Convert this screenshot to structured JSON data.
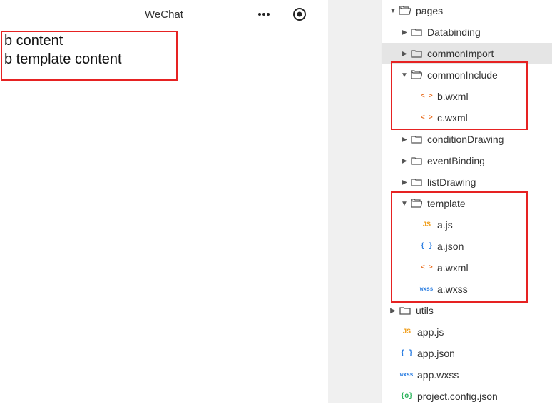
{
  "sim": {
    "title": "WeChat",
    "lines": [
      "b content",
      "b template content"
    ]
  },
  "tree": {
    "pages_label": "pages",
    "children": {
      "databinding": "Databinding",
      "commonImport": "commonImport",
      "commonInclude": "commonInclude",
      "conditionDrawing": "conditionDrawing",
      "eventBinding": "eventBinding",
      "listDrawing": "listDrawing",
      "template": "template",
      "utils": "utils"
    },
    "commonInclude_files": {
      "b_wxml": "b.wxml",
      "c_wxml": "c.wxml"
    },
    "template_files": {
      "a_js": "a.js",
      "a_json": "a.json",
      "a_wxml": "a.wxml",
      "a_wxss": "a.wxss"
    },
    "root_files": {
      "app_js": "app.js",
      "app_json": "app.json",
      "app_wxss": "app.wxss",
      "project_config": "project.config.json"
    }
  },
  "icons": {
    "js": "JS",
    "json": "{ }",
    "wxml": "< >",
    "wxss": "wxss",
    "proj": "{o}"
  }
}
